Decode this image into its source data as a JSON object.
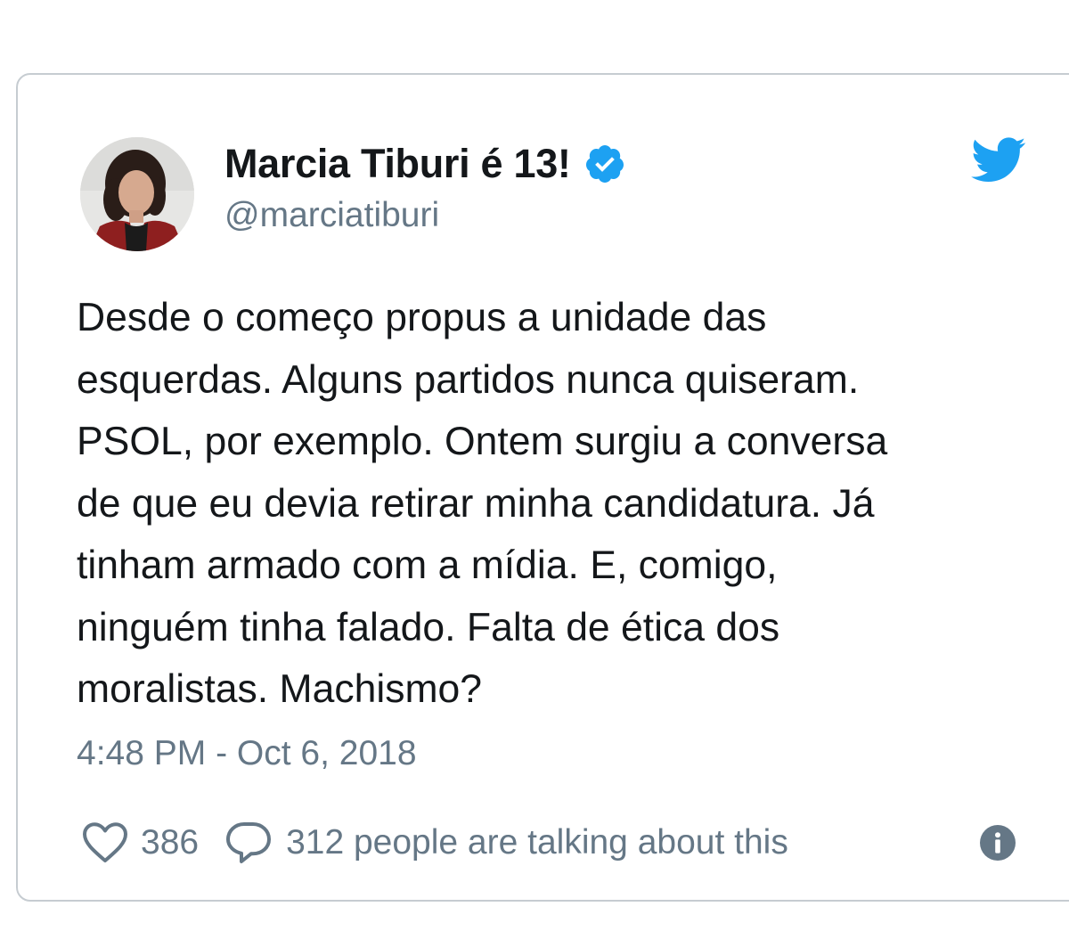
{
  "tweet": {
    "display_name": "Marcia Tiburi é 13!",
    "handle": "@marciatiburi",
    "verified": true,
    "text_lines": [
      "Desde o começo propus a unidade das",
      "esquerdas. Alguns partidos nunca quiseram.",
      "PSOL, por exemplo. Ontem surgiu a conversa",
      "de que eu devia retirar minha candidatura. Já",
      "tinham armado com a mídia. E, comigo,",
      "ninguém tinha falado. Falta de ética dos",
      "moralistas. Machismo?"
    ],
    "timestamp": "4:48 PM - Oct 6, 2018",
    "like_count": "386",
    "talking_text": "312 people are talking about this"
  },
  "icons": {
    "verified": "verified-badge-icon",
    "brand": "twitter-bird-icon",
    "like": "heart-icon",
    "reply": "comment-bubble-icon",
    "info": "info-icon"
  },
  "colors": {
    "text": "#14171a",
    "secondary": "#657786",
    "brand_blue": "#1da1f2",
    "card_border": "#c6ccd1"
  }
}
